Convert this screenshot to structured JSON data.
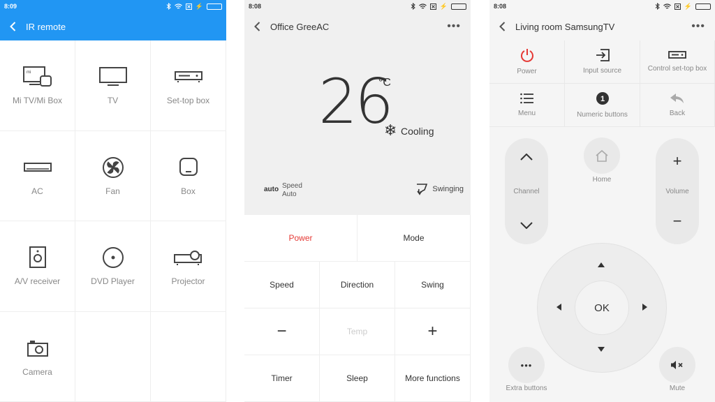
{
  "screen1": {
    "status_time": "8:09",
    "title": "IR remote",
    "devices": [
      {
        "label": "Mi TV/Mi Box",
        "icon": "mi-tv-box-icon"
      },
      {
        "label": "TV",
        "icon": "tv-icon"
      },
      {
        "label": "Set-top box",
        "icon": "set-top-box-icon"
      },
      {
        "label": "AC",
        "icon": "ac-icon"
      },
      {
        "label": "Fan",
        "icon": "fan-icon"
      },
      {
        "label": "Box",
        "icon": "box-icon"
      },
      {
        "label": "A/V receiver",
        "icon": "av-receiver-icon"
      },
      {
        "label": "DVD Player",
        "icon": "dvd-player-icon"
      },
      {
        "label": "Projector",
        "icon": "projector-icon"
      },
      {
        "label": "Camera",
        "icon": "camera-icon"
      }
    ]
  },
  "screen2": {
    "status_time": "8:08",
    "title": "Office GreeAC",
    "temperature": "26",
    "unit": "°C",
    "mode": "Cooling",
    "auto_tag": "auto",
    "speed_label": "Speed",
    "speed_value": "Auto",
    "swing_state": "Swinging",
    "buttons": {
      "power": "Power",
      "mode": "Mode",
      "speed": "Speed",
      "direction": "Direction",
      "swing": "Swing",
      "minus": "−",
      "temp": "Temp",
      "plus": "+",
      "timer": "Timer",
      "sleep": "Sleep",
      "more": "More functions"
    },
    "power_color": "#e53935"
  },
  "screen3": {
    "status_time": "8:08",
    "title": "Living room SamsungTV",
    "top": {
      "power": "Power",
      "input": "Input source",
      "stb": "Control set-top box",
      "menu": "Menu",
      "numeric": "Numeric buttons",
      "back": "Back"
    },
    "channel": "Channel",
    "home": "Home",
    "volume": "Volume",
    "ok": "OK",
    "extra": "Extra buttons",
    "mute": "Mute"
  },
  "colors": {
    "accent": "#2196f3",
    "battery": "#38c24a"
  }
}
